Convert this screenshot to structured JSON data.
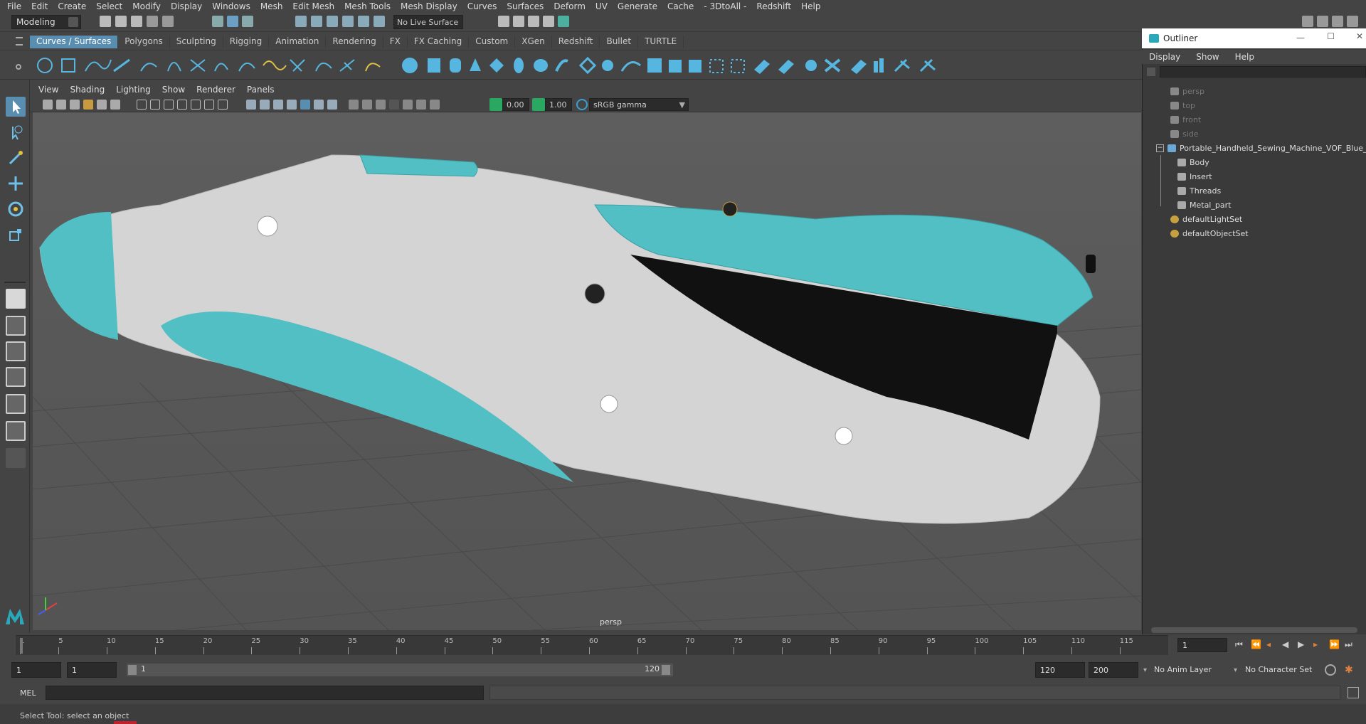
{
  "menubar": [
    "File",
    "Edit",
    "Create",
    "Select",
    "Modify",
    "Display",
    "Windows",
    "Mesh",
    "Edit Mesh",
    "Mesh Tools",
    "Mesh Display",
    "Curves",
    "Surfaces",
    "Deform",
    "UV",
    "Generate",
    "Cache",
    "- 3DtoAll -",
    "Redshift",
    "Help"
  ],
  "status_line": {
    "mode": "Modeling",
    "live_surface": "No Live Surface"
  },
  "shelf_tabs": [
    "Curves / Surfaces",
    "Polygons",
    "Sculpting",
    "Rigging",
    "Animation",
    "Rendering",
    "FX",
    "FX Caching",
    "Custom",
    "XGen",
    "Redshift",
    "Bullet",
    "TURTLE"
  ],
  "shelf_active_tab": "Curves / Surfaces",
  "viewport": {
    "menu": [
      "View",
      "Shading",
      "Lighting",
      "Show",
      "Renderer",
      "Panels"
    ],
    "exposure": "0.00",
    "gamma": "1.00",
    "color_space": "sRGB gamma",
    "camera_label": "persp"
  },
  "outliner": {
    "title": "Outliner",
    "menu": [
      "Display",
      "Show",
      "Help"
    ],
    "items": [
      {
        "label": "persp",
        "kind": "camera",
        "dim": true
      },
      {
        "label": "top",
        "kind": "camera",
        "dim": true
      },
      {
        "label": "front",
        "kind": "camera",
        "dim": true
      },
      {
        "label": "side",
        "kind": "camera",
        "dim": true
      },
      {
        "label": "Portable_Handheld_Sewing_Machine_VOF_Blue_",
        "kind": "group",
        "dim": false
      },
      {
        "label": "Body",
        "kind": "mesh",
        "dim": false
      },
      {
        "label": "Insert",
        "kind": "mesh",
        "dim": false
      },
      {
        "label": "Threads",
        "kind": "mesh",
        "dim": false
      },
      {
        "label": "Metal_part",
        "kind": "mesh",
        "dim": false
      },
      {
        "label": "defaultLightSet",
        "kind": "set",
        "dim": false
      },
      {
        "label": "defaultObjectSet",
        "kind": "set",
        "dim": false
      }
    ]
  },
  "timeline": {
    "ticks": [
      "1",
      "5",
      "10",
      "15",
      "20",
      "25",
      "30",
      "35",
      "40",
      "45",
      "50",
      "55",
      "60",
      "65",
      "70",
      "75",
      "80",
      "85",
      "90",
      "95",
      "100",
      "105",
      "110",
      "115"
    ],
    "current_frame": "1"
  },
  "range": {
    "start": "1",
    "playback_start": "1",
    "slider_start": "1",
    "slider_end": "120",
    "playback_end": "120",
    "end": "200",
    "anim_layer": "No Anim Layer",
    "character_set": "No Character Set"
  },
  "command_line": {
    "label": "MEL"
  },
  "help_line": "Select Tool: select an object",
  "colors": {
    "accent": "#5a8eb0",
    "model_teal": "#52bfc4",
    "model_body": "#d4d4d4"
  },
  "icons": [
    "select-tool-icon",
    "lasso-tool-icon",
    "paint-select-icon",
    "move-tool-icon",
    "rotate-tool-icon",
    "scale-tool-icon"
  ]
}
